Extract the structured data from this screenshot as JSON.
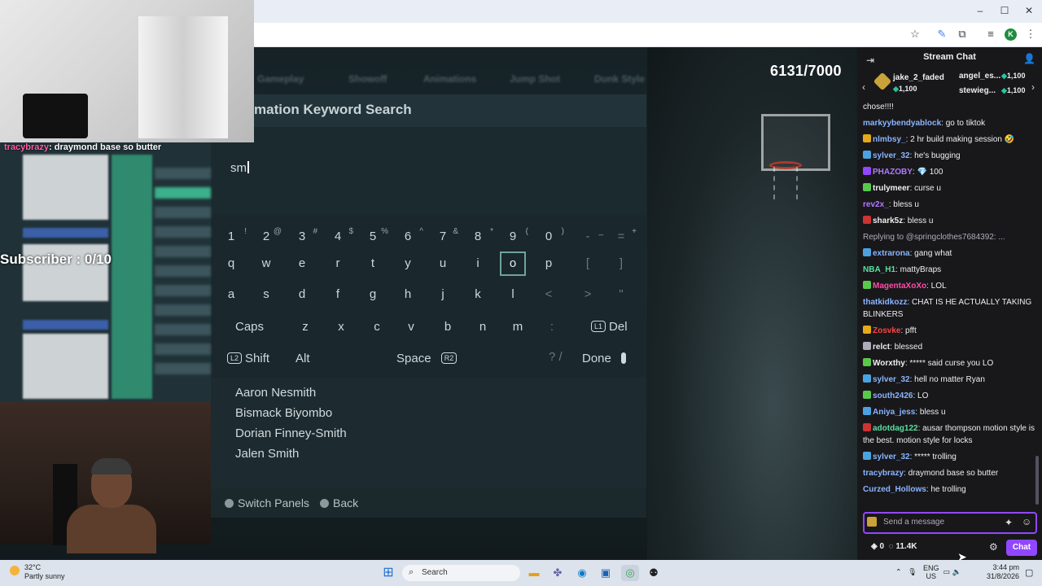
{
  "window": {
    "minimize": "–",
    "maximize": "☐",
    "close": "✕"
  },
  "toolbar": {
    "star": "☆",
    "extensions": "⧉",
    "profile_initial": "K",
    "menu": "⋮"
  },
  "game": {
    "score": "6131/7000",
    "tabs": [
      "Gameplay",
      "Showoff",
      "Animations",
      "Jump Shot",
      "Dunk Style"
    ],
    "panel_title": "mation Keyword Search",
    "search_value": "sm",
    "keyboard": {
      "row1": [
        {
          "k": "1",
          "s": "!"
        },
        {
          "k": "2",
          "s": "@"
        },
        {
          "k": "3",
          "s": "#"
        },
        {
          "k": "4",
          "s": "$"
        },
        {
          "k": "5",
          "s": "%"
        },
        {
          "k": "6",
          "s": "^"
        },
        {
          "k": "7",
          "s": "&"
        },
        {
          "k": "8",
          "s": "*"
        },
        {
          "k": "9",
          "s": "("
        },
        {
          "k": "0",
          "s": ")"
        },
        {
          "k": "-",
          "s": "_"
        },
        {
          "k": "=",
          "s": "+"
        }
      ],
      "row2": [
        "q",
        "w",
        "e",
        "r",
        "t",
        "y",
        "u",
        "i",
        "o",
        "p",
        "[",
        "]"
      ],
      "row3": [
        "a",
        "s",
        "d",
        "f",
        "g",
        "h",
        "j",
        "k",
        "l",
        "<",
        ">",
        "\""
      ],
      "row4": [
        "z",
        "x",
        "c",
        "v",
        "b",
        "n",
        "m",
        ":"
      ],
      "selected_key": "o",
      "caps": "Caps",
      "del_glyph": "L1",
      "del": "Del",
      "shift_glyph": "L2",
      "shift": "Shift",
      "alt": "Alt",
      "space": "Space",
      "space_glyph": "R2",
      "slash": "? /",
      "done": "Done"
    },
    "results": [
      "Aaron Nesmith",
      "Bismack Biyombo",
      "Dorian Finney-Smith",
      "Jalen Smith"
    ],
    "footer": {
      "switch": "Switch Panels",
      "back": "Back"
    }
  },
  "overlay": {
    "subscriber": "Subscriber : 0/10",
    "cam_chat_user": "tracybrazy",
    "cam_chat_text": ": draymond base so butter"
  },
  "chat": {
    "title": "Stream Chat",
    "gifters": [
      {
        "name": "jake_2_faded",
        "value": "1,100"
      },
      {
        "name": "angel_es...",
        "value": "1,100"
      },
      {
        "name": "stewieg...",
        "value": "1,100"
      }
    ],
    "messages": [
      {
        "user": "",
        "text": "chose!!!!",
        "color": "#efeff1",
        "badge": ""
      },
      {
        "user": "markyybendyablock",
        "text": ": go to tiktok",
        "color": "#8ab4ff",
        "badge": ""
      },
      {
        "user": "nlmbsy_",
        "text": ": 2 hr build making session 🤣",
        "color": "#8ab4ff",
        "badge": "#e5a91a"
      },
      {
        "user": "sylver_32",
        "text": ": he's bugging",
        "color": "#8ab4ff",
        "badge": "#4aa3e0"
      },
      {
        "user": "PHAZOBY",
        "text": ": 💎 100",
        "color": "#b07cff",
        "badge": "#9147ff"
      },
      {
        "user": "trulymeer",
        "text": ": curse u",
        "color": "#efeff1",
        "badge": "#59c94b"
      },
      {
        "user": "rev2x_",
        "text": ": bless u",
        "color": "#b07cff",
        "badge": ""
      },
      {
        "user": "shark5z",
        "text": ": bless u",
        "color": "#efeff1",
        "badge": "#c33"
      },
      {
        "user": "",
        "text": "Replying to @springclothes7684392: ...",
        "color": "#adadb8",
        "badge": ""
      },
      {
        "user": "extrarona",
        "text": ": gang what",
        "color": "#8ab4ff",
        "badge": "#4aa3e0"
      },
      {
        "user": "NBA_H1",
        "text": ": mattyBraps",
        "color": "#59e0a0",
        "badge": ""
      },
      {
        "user": "MagentaXoXo",
        "text": ": LOL",
        "color": "#ff4da6",
        "badge": "#59c94b"
      },
      {
        "user": "thatkidkozz",
        "text": ": CHAT IS HE ACTUALLY TAKING BLINKERS",
        "color": "#8ab4ff",
        "badge": ""
      },
      {
        "user": "Zosvke",
        "text": ": pfft",
        "color": "#ff4444",
        "badge": "#e5a91a"
      },
      {
        "user": "relct",
        "text": ": blessed",
        "color": "#efeff1",
        "badge": "#adadb8"
      },
      {
        "user": "Worxthy",
        "text": ": ***** said curse you LO",
        "color": "#efeff1",
        "badge": "#59c94b"
      },
      {
        "user": "sylver_32",
        "text": ": hell no matter Ryan",
        "color": "#8ab4ff",
        "badge": "#4aa3e0"
      },
      {
        "user": "south2426",
        "text": ": LO",
        "color": "#8ab4ff",
        "badge": "#59c94b"
      },
      {
        "user": "Aniya_jess",
        "text": ": bless u",
        "color": "#8ab4ff",
        "badge": "#4aa3e0"
      },
      {
        "user": "adotdag122",
        "text": ": ausar thompson motion style is the best. motion style for locks",
        "color": "#59e0a0",
        "badge": "#c33"
      },
      {
        "user": "sylver_32",
        "text": ": ***** trolling",
        "color": "#8ab4ff",
        "badge": "#4aa3e0"
      },
      {
        "user": "tracybrazy",
        "text": ": draymond base so butter",
        "color": "#8ab4ff",
        "badge": ""
      },
      {
        "user": "Curzed_Hollows",
        "text": ": he trolling",
        "color": "#8ab4ff",
        "badge": ""
      }
    ],
    "input_placeholder": "Send a message",
    "points": "0",
    "viewers": "11.4K",
    "send": "Chat"
  },
  "taskbar": {
    "temp": "32°C",
    "weather": "Partly sunny",
    "search": "Search",
    "lang1": "ENG",
    "lang2": "US",
    "time": "3:44 pm",
    "date": "31/8/2026"
  },
  "colors": {
    "accent": "#9147ff",
    "game_panel": "#1d2b30",
    "selected_key": "#6fa39a"
  }
}
